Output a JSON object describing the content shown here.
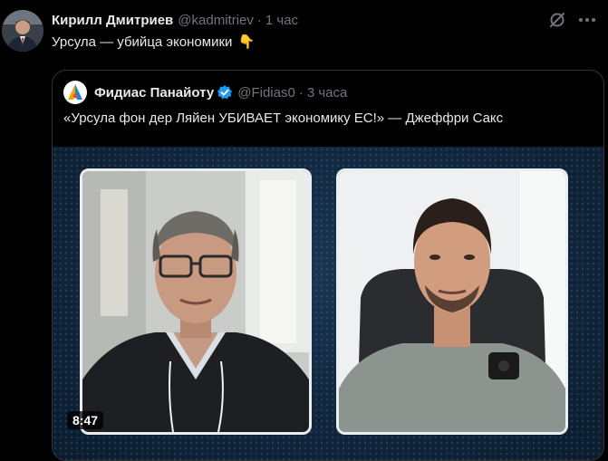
{
  "post": {
    "author_name": "Кирилл Дмитриев",
    "author_handle": "@kadmitriev",
    "separator": "·",
    "time": "1 час",
    "text": "Урсула — убийца экономики",
    "emoji": "👇",
    "icons": {
      "grok": "grok-icon",
      "more": "more-icon"
    }
  },
  "quote": {
    "author_name": "Фидиас Панайоту",
    "verified": "verified-badge-icon",
    "author_handle": "@Fidias0",
    "separator": "·",
    "time": "3 часа",
    "text": "«Урсула фон дер Ляйен УБИВАЕТ экономику ЕС!» — Джеффри Сакс",
    "video": {
      "duration": "8:47"
    }
  },
  "colors": {
    "background": "#000000",
    "text": "#e7e9ea",
    "muted": "#71767b",
    "border": "#2f3336",
    "verified": "#1d9bf0"
  }
}
